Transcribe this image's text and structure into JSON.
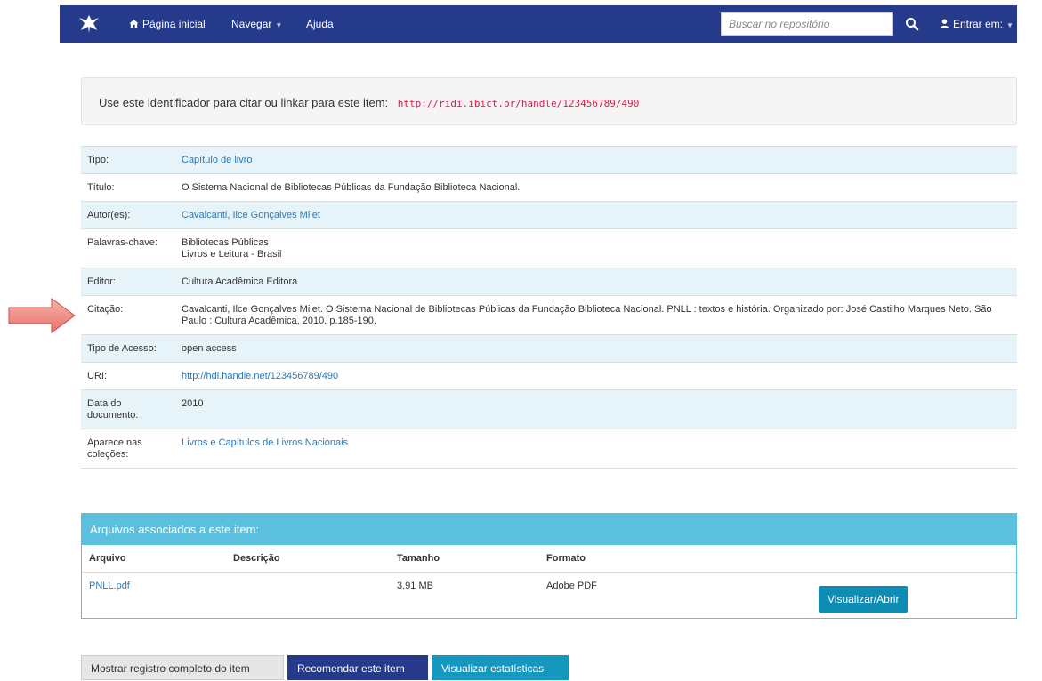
{
  "navbar": {
    "home_label": "Página inicial",
    "browse_label": "Navegar",
    "help_label": "Ajuda",
    "search_placeholder": "Buscar no repositório",
    "login_label": "Entrar em:"
  },
  "identifier": {
    "text": "Use este identificador para citar ou linkar para este item:",
    "url": "http://ridi.ibict.br/handle/123456789/490"
  },
  "metadata": {
    "tipo": {
      "label": "Tipo:",
      "value": "Capítulo de livro"
    },
    "titulo": {
      "label": "Título:",
      "value": "O Sistema Nacional de Bibliotecas Públicas da Fundação Biblioteca Nacional."
    },
    "autor": {
      "label": "Autor(es):",
      "value": "Cavalcanti, Ilce Gonçalves Milet"
    },
    "palavras": {
      "label": "Palavras-chave:",
      "values": [
        "Bibliotecas Públicas",
        "Livros e Leitura - Brasil"
      ]
    },
    "editor": {
      "label": "Editor:",
      "value": "Cultura Acadêmica Editora"
    },
    "citacao": {
      "label": "Citação:",
      "value": "Cavalcanti, Ilce Gonçalves Milet. O Sistema Nacional de Bibliotecas Públicas da Fundação Biblioteca Nacional. PNLL : textos e história. Organizado por: José Castilho Marques Neto. São Paulo : Cultura Acadêmica, 2010. p.185-190."
    },
    "acesso": {
      "label": "Tipo de Acesso:",
      "value": "open access"
    },
    "uri": {
      "label": "URI:",
      "value": "http://hdl.handle.net/123456789/490"
    },
    "data": {
      "label": "Data do documento:",
      "value": "2010"
    },
    "colecoes": {
      "label": "Aparece nas coleções:",
      "value": "Livros e Capítulos de Livros Nacionais"
    }
  },
  "files": {
    "heading": "Arquivos associados a este item:",
    "columns": [
      "Arquivo",
      "Descrição",
      "Tamanho",
      "Formato"
    ],
    "rows": [
      {
        "file": "PNLL.pdf",
        "description": "",
        "size": "3,91 MB",
        "format": "Adobe PDF",
        "action": "Visualizar/Abrir"
      }
    ]
  },
  "actions": {
    "full_record": "Mostrar registro completo do item",
    "recommend": "Recomendar este item",
    "stats": "Visualizar estatísticas"
  },
  "colors": {
    "navbar": "#253a8a",
    "panel": "#5bc0de",
    "row_stripe": "#e6f3f9",
    "link": "#2a7ab7",
    "arrow": "#e8706b"
  }
}
